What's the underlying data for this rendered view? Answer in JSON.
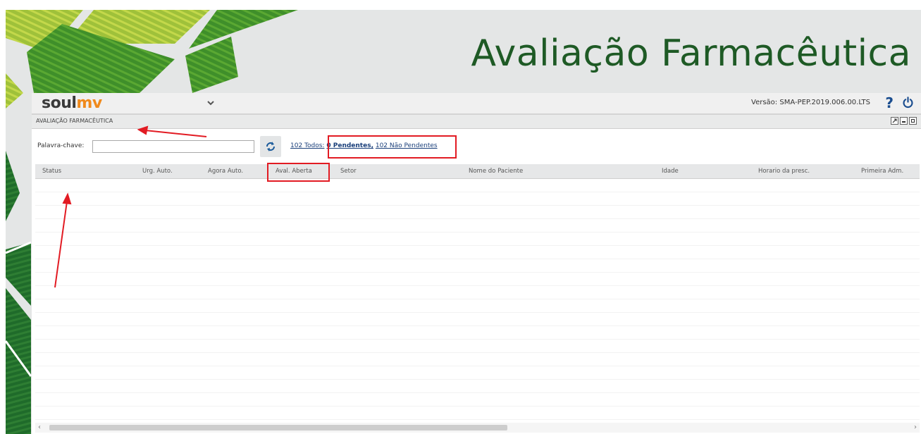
{
  "slide": {
    "title": "Avaliação Farmacêutica",
    "title_color": "#1e5a25"
  },
  "app": {
    "logo_part1": "soul",
    "logo_part2": "mv",
    "logo_colors": {
      "soul": "#3a3a3a",
      "mv": "#f08a1c"
    },
    "menu_icon": "chevron-down-icon",
    "version": "Versão: SMA-PEP.2019.006.00.LTS",
    "help_label": "?",
    "power_icon": "power-icon"
  },
  "panel": {
    "title": "AVALIAÇÃO FARMACÊUTICA",
    "window_icons": [
      "expand-icon",
      "minimize-icon",
      "maximize-icon"
    ]
  },
  "search": {
    "label": "Palavra-chave:",
    "value": "",
    "refresh_icon": "refresh-icon"
  },
  "filters": {
    "todos": "102 Todos:",
    "pendentes": "0 Pendentes,",
    "nao_pendentes": "102 Não Pendentes"
  },
  "table": {
    "columns": [
      "Status",
      "Urg. Auto.",
      "Agora Auto.",
      "Aval. Aberta",
      "Setor",
      "Nome do Paciente",
      "Idade",
      "Horario da presc.",
      "Primeira Adm."
    ],
    "rows": []
  },
  "scrollbar": {
    "left": "‹",
    "right": "›"
  },
  "annotation_color": "#e21b23"
}
